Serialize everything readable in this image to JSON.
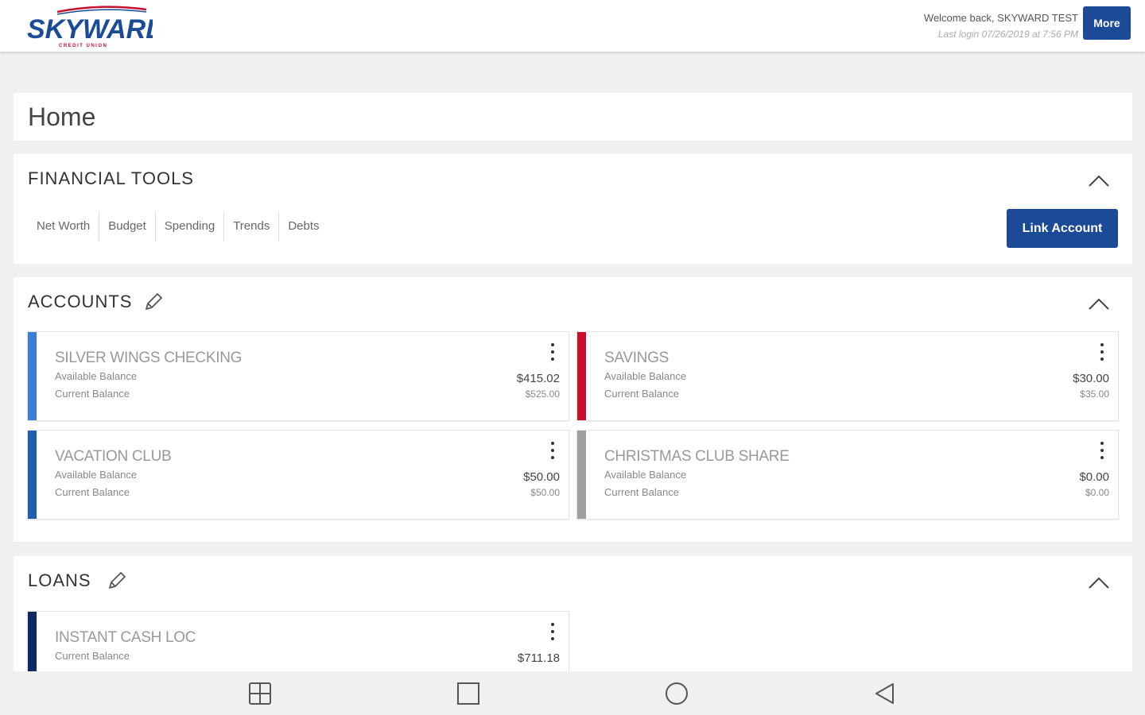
{
  "header": {
    "logo_text": "SKYWARD",
    "logo_subtext": "CREDIT UNION",
    "welcome_text": "Welcome back, SKYWARD TEST",
    "last_login": "Last login 07/26/2019 at 7:56 PM",
    "more_label": "More"
  },
  "home": {
    "title": "Home"
  },
  "financial_tools": {
    "title": "FINANCIAL TOOLS",
    "tools": [
      "Net Worth",
      "Budget",
      "Spending",
      "Trends",
      "Debts"
    ],
    "link_account_label": "Link Account"
  },
  "accounts": {
    "title": "ACCOUNTS",
    "items": [
      {
        "name": "SILVER WINGS CHECKING",
        "label1": "Available Balance",
        "value1": "$415.02",
        "label2": "Current Balance",
        "value2": "$525.00",
        "color": "#3a7fd5"
      },
      {
        "name": "SAVINGS",
        "label1": "Available Balance",
        "value1": "$30.00",
        "label2": "Current Balance",
        "value2": "$35.00",
        "color": "#c8102e"
      },
      {
        "name": "VACATION CLUB",
        "label1": "Available Balance",
        "value1": "$50.00",
        "label2": "Current Balance",
        "value2": "$50.00",
        "color": "#1f5fae"
      },
      {
        "name": "CHRISTMAS CLUB SHARE",
        "label1": "Available Balance",
        "value1": "$0.00",
        "label2": "Current Balance",
        "value2": "$0.00",
        "color": "#9e9e9e"
      }
    ]
  },
  "loans": {
    "title": "LOANS",
    "items": [
      {
        "name": "INSTANT CASH LOC",
        "label1": "Current Balance",
        "value1": "$711.18",
        "color": "#0d2a66"
      }
    ]
  },
  "colors": {
    "brand_blue": "#1b4b96",
    "logo_red": "#c8102e"
  },
  "icons": {
    "edit": "pencil-icon",
    "collapse": "chevron-up-icon",
    "card_menu": "kebab-menu-icon",
    "nav": [
      "apps-grid-icon",
      "recents-square-icon",
      "home-circle-icon",
      "back-triangle-icon"
    ]
  }
}
